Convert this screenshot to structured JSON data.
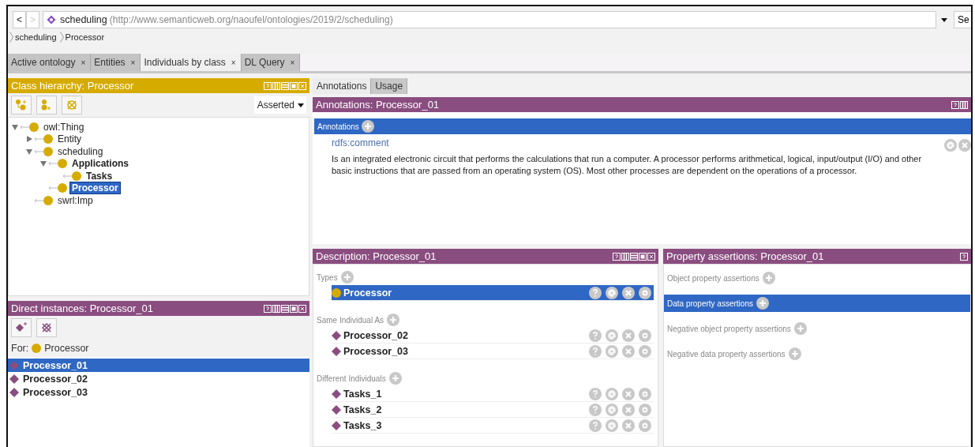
{
  "nav": {
    "back": "<",
    "forward": ">",
    "ontology_name": "scheduling",
    "ontology_iri": "(http://www.semanticweb.org/naoufel/ontologies/2019/2/scheduling)",
    "search_button": "Se"
  },
  "breadcrumb": [
    "scheduling",
    "Processor"
  ],
  "tabs": [
    {
      "label": "Active ontology",
      "close": "×",
      "selected": false
    },
    {
      "label": "Entities",
      "close": "×",
      "selected": false
    },
    {
      "label": "Individuals by class",
      "close": "×",
      "selected": true
    },
    {
      "label": "DL Query",
      "close": "×",
      "selected": false
    }
  ],
  "class_hierarchy": {
    "title": "Class hierarchy: Processor",
    "mode": "Asserted",
    "tree": [
      {
        "label": "owl:Thing",
        "bold": false,
        "selected": false,
        "expanded": true,
        "children": [
          {
            "label": "Entity",
            "bold": false,
            "selected": false,
            "expanded": false
          },
          {
            "label": "scheduling",
            "bold": false,
            "selected": false,
            "expanded": true,
            "children": [
              {
                "label": "Applications",
                "bold": true,
                "selected": false,
                "expanded": true,
                "children": [
                  {
                    "label": "Tasks",
                    "bold": true,
                    "selected": false
                  }
                ]
              },
              {
                "label": "Processor",
                "bold": true,
                "selected": true
              }
            ]
          },
          {
            "label": "swrl:Imp",
            "bold": false,
            "selected": false
          }
        ]
      }
    ]
  },
  "direct_instances": {
    "title": "Direct instances: Processor_01",
    "for_label": "For:",
    "for_class": "Processor",
    "items": [
      {
        "label": "Processor_01",
        "selected": true
      },
      {
        "label": "Processor_02",
        "selected": false
      },
      {
        "label": "Processor_03",
        "selected": false
      }
    ]
  },
  "entity_tabs": [
    {
      "label": "Annotations",
      "selected": true
    },
    {
      "label": "Usage",
      "selected": false
    }
  ],
  "annotations": {
    "title": "Annotations: Processor_01",
    "section": "Annotations",
    "property": "rdfs:comment",
    "value": "Is an integrated electronic circuit that performs the calculations that run a computer. A processor performs arithmetical, logical, input/output (I/O) and other basic instructions that are passed from an operating system (OS). Most other processes are dependent on the operations of a processor."
  },
  "description": {
    "title": "Description: Processor_01",
    "sections": [
      {
        "label": "Types",
        "items": [
          {
            "kind": "class",
            "label": "Processor",
            "selected": true
          }
        ]
      },
      {
        "label": "Same Individual As",
        "items": [
          {
            "kind": "individual",
            "label": "Processor_02",
            "selected": false
          },
          {
            "kind": "individual",
            "label": "Processor_03",
            "selected": false
          }
        ]
      },
      {
        "label": "Different Individuals",
        "items": [
          {
            "kind": "individual",
            "label": "Tasks_1",
            "selected": false
          },
          {
            "kind": "individual",
            "label": "Tasks_2",
            "selected": false
          },
          {
            "kind": "individual",
            "label": "Tasks_3",
            "selected": false
          }
        ]
      }
    ]
  },
  "property_assertions": {
    "title": "Property assertions: Processor_01",
    "sections": [
      {
        "label": "Object property assertions",
        "selected": false
      },
      {
        "label": "Data property assertions",
        "selected": true
      },
      {
        "label": "Negative object property assertions",
        "selected": false
      },
      {
        "label": "Negative data property assertions",
        "selected": false
      }
    ]
  }
}
